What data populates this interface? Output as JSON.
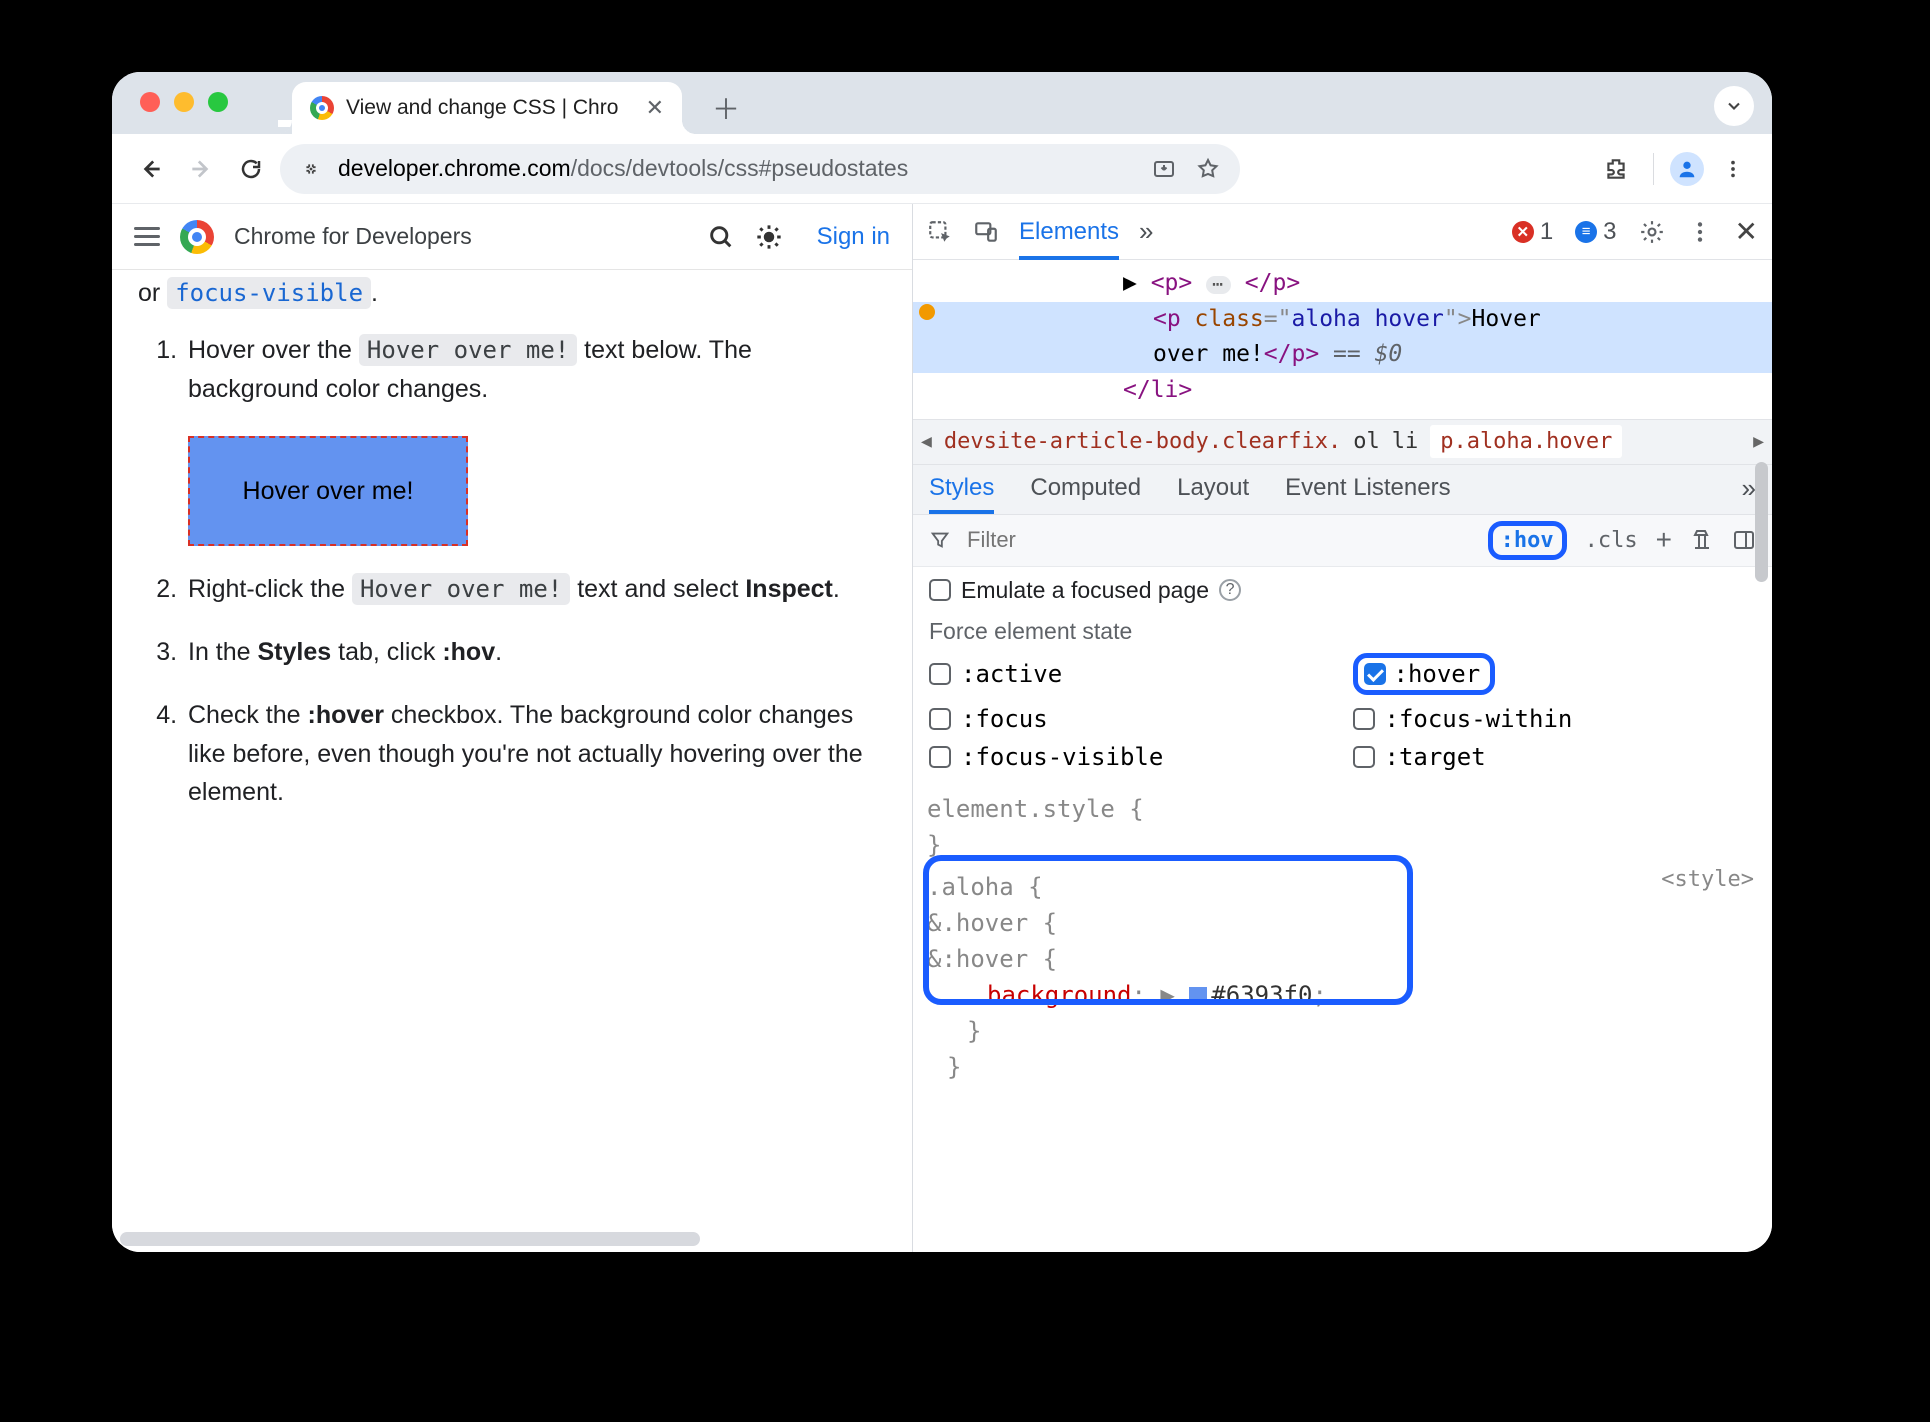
{
  "browser": {
    "tab_title": "View and change CSS  |  Chro",
    "url_host": "developer.chrome.com",
    "url_path": "/docs/devtools/css#pseudostates"
  },
  "page": {
    "brand": "Chrome for Developers",
    "signin": "Sign in",
    "intro_or": "or ",
    "intro_code": "focus-visible",
    "intro_period": ".",
    "steps": [
      {
        "pre": "Hover over the ",
        "code": "Hover over me!",
        "post": " text below. The background color changes."
      },
      {
        "pre": "Right-click the ",
        "code": "Hover over me!",
        "post": " text and select ",
        "bold": "Inspect",
        "tail": "."
      },
      {
        "t": "In the ",
        "b1": "Styles",
        "m": " tab, click ",
        "b2": ":hov",
        "tail": "."
      },
      {
        "t": "Check the ",
        "b1": ":hover",
        "m": " checkbox. The background color changes like before, even though you're not actually hovering over the element."
      }
    ],
    "hover_box": "Hover over me!"
  },
  "devtools": {
    "main_tabs": {
      "elements": "Elements"
    },
    "error_count": "1",
    "msg_count": "3",
    "dom": {
      "l1a": "▶ ",
      "l1_open": "<p>",
      "l1_close": " </p>",
      "l2_open": "<p ",
      "l2_attrn": "class",
      "l2_eq": "=\"",
      "l2_attrv": "aloha hover",
      "l2_eq2": "\">",
      "l2_text": "Hover ",
      "l3_text": "over me!",
      "l3_close": "</p>",
      "l3_eq": " == ",
      "l3_sel": "$0",
      "l4": "</li>"
    },
    "crumbs": [
      "devsite-article-body.clearfix.",
      "ol",
      "li",
      "p.aloha.hover"
    ],
    "subtabs": [
      "Styles",
      "Computed",
      "Layout",
      "Event Listeners"
    ],
    "filter_placeholder": "Filter",
    "hov_chip": ":hov",
    "cls_chip": ".cls",
    "emulate": "Emulate a focused page",
    "force_title": "Force element state",
    "states": {
      "active": ":active",
      "hover": ":hover",
      "focus": ":focus",
      "focus_within": ":focus-within",
      "focus_visible": ":focus-visible",
      "target": ":target"
    },
    "rules": {
      "element_style": "element.style {",
      "close": "}",
      "sel1": ".aloha {",
      "sel2": " &.hover {",
      "sel3": "  &:hover {",
      "prop": "background",
      "val": "#6393f0",
      "src": "<style>"
    }
  }
}
